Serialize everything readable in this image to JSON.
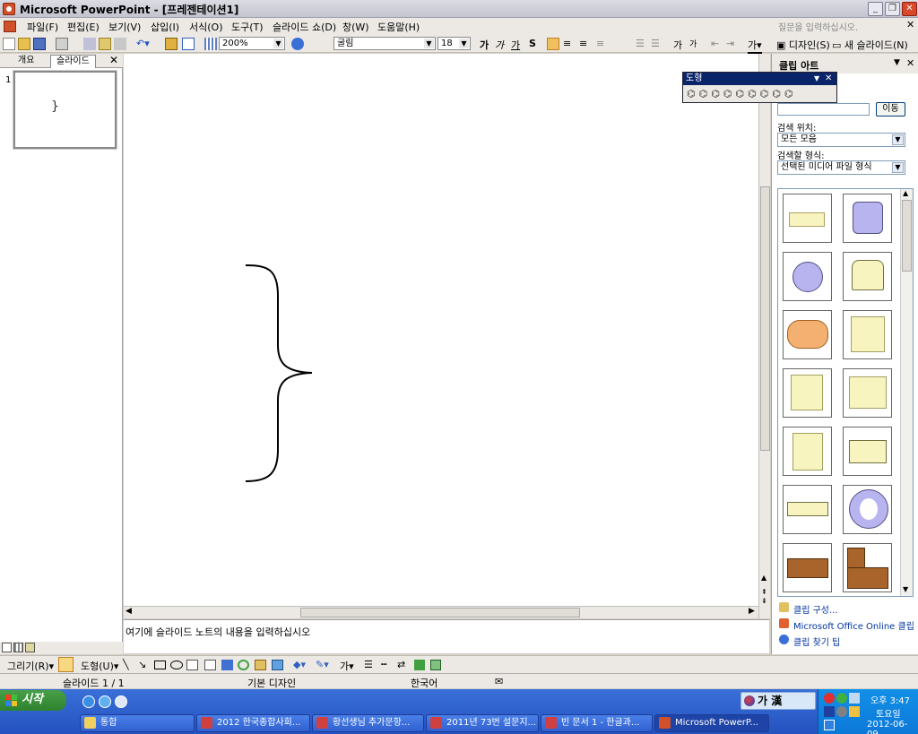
{
  "window": {
    "title": "Microsoft PowerPoint - [프레젠테이션1]"
  },
  "menu": {
    "items": [
      "파일(F)",
      "편집(E)",
      "보기(V)",
      "삽입(I)",
      "서식(O)",
      "도구(T)",
      "슬라이드 쇼(D)",
      "창(W)",
      "도움말(H)"
    ],
    "help_placeholder": "질문을 입력하십시오."
  },
  "toolbar": {
    "zoom": "200%",
    "font": "굴림",
    "size": "18",
    "design_label": "디자인(S)",
    "new_slide_label": "새 슬라이드(N)"
  },
  "left_panel": {
    "tab_outline": "개요",
    "tab_slides": "슬라이드",
    "slide_number": "1",
    "thumb_text": "}"
  },
  "notes": {
    "placeholder": "여기에 슬라이드 노트의 내용을 입력하십시오"
  },
  "drawing": {
    "draw_label": "그리기(R)",
    "shapes_label": "도형(U)"
  },
  "status": {
    "slide": "슬라이드 1 / 1",
    "design": "기본 디자인",
    "language": "한국어"
  },
  "shapes_toolbar": {
    "title": "도형"
  },
  "task_pane": {
    "title": "클립 아트",
    "go_button": "이동",
    "search_in_label": "검색 위치:",
    "search_in_value": "모든 모음",
    "results_label": "검색할 형식:",
    "results_value": "선택된 미디어 파일 형식",
    "links": [
      "클립 구성...",
      "Microsoft Office Online 클립 아",
      "클립 찾기 팁"
    ]
  },
  "taskbar": {
    "start": "시작",
    "tasks": [
      "통합",
      "2012 한국종합사회...",
      "황선생님 추가문항...",
      "2011년 73번 설문지...",
      "빈 문서 1 - 한글과...",
      "Microsoft PowerP..."
    ],
    "lang": "가 漢",
    "clock_time": "오후 3:47",
    "clock_day": "토요일",
    "clock_date": "2012-06-09"
  },
  "colors": {
    "clip_yellow": "#f8f4c0",
    "clip_purple": "#b8b4f0",
    "clip_orange": "#f4b070",
    "clip_brown": "#a8642a",
    "accent_blue": "#0a246a"
  }
}
